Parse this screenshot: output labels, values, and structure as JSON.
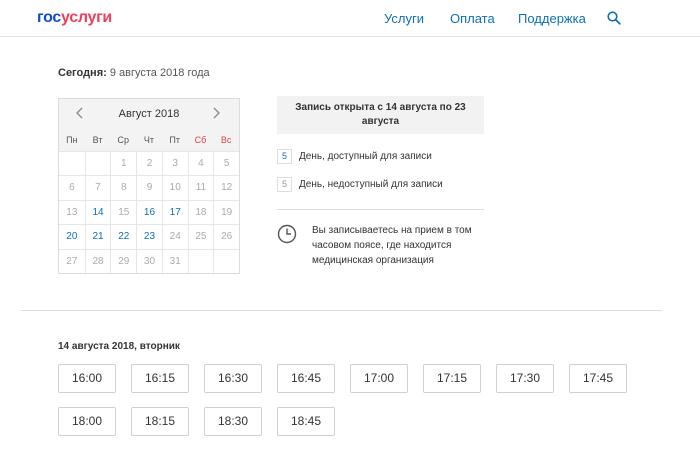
{
  "header": {
    "logo_part1": "гос",
    "logo_part2": "услуги",
    "nav": [
      {
        "label": "Услуги"
      },
      {
        "label": "Оплата"
      },
      {
        "label": "Поддержка"
      }
    ],
    "search_icon": "search-icon"
  },
  "today": {
    "label": "Сегодня:",
    "value": "9 августа 2018 года"
  },
  "calendar": {
    "title": "Август 2018",
    "weekdays": [
      "Пн",
      "Вт",
      "Ср",
      "Чт",
      "Пт",
      "Сб",
      "Вс"
    ],
    "weekend_color": "#e44444",
    "available_color": "#0d6fb8",
    "cells": [
      {
        "d": "",
        "a": false
      },
      {
        "d": "",
        "a": false
      },
      {
        "d": "1",
        "a": false
      },
      {
        "d": "2",
        "a": false
      },
      {
        "d": "3",
        "a": false
      },
      {
        "d": "4",
        "a": false
      },
      {
        "d": "5",
        "a": false
      },
      {
        "d": "6",
        "a": false
      },
      {
        "d": "7",
        "a": false
      },
      {
        "d": "8",
        "a": false
      },
      {
        "d": "9",
        "a": false
      },
      {
        "d": "10",
        "a": false
      },
      {
        "d": "11",
        "a": false
      },
      {
        "d": "12",
        "a": false
      },
      {
        "d": "13",
        "a": false
      },
      {
        "d": "14",
        "a": true
      },
      {
        "d": "15",
        "a": false
      },
      {
        "d": "16",
        "a": true
      },
      {
        "d": "17",
        "a": true
      },
      {
        "d": "18",
        "a": false
      },
      {
        "d": "19",
        "a": false
      },
      {
        "d": "20",
        "a": true
      },
      {
        "d": "21",
        "a": true
      },
      {
        "d": "22",
        "a": true
      },
      {
        "d": "23",
        "a": true
      },
      {
        "d": "24",
        "a": false
      },
      {
        "d": "25",
        "a": false
      },
      {
        "d": "26",
        "a": false
      },
      {
        "d": "27",
        "a": false
      },
      {
        "d": "28",
        "a": false
      },
      {
        "d": "29",
        "a": false
      },
      {
        "d": "30",
        "a": false
      },
      {
        "d": "31",
        "a": false
      },
      {
        "d": "",
        "a": false
      },
      {
        "d": "",
        "a": false
      }
    ]
  },
  "info": {
    "record_open": "Запись открыта с 14 августа по 23 августа",
    "legend_available_num": "5",
    "legend_available": "День, доступный для записи",
    "legend_unavailable_num": "5",
    "legend_unavailable": "День, недоступный для записи",
    "timezone_note": "Вы записываетесь на прием в том часовом поясе, где находится медицинская организация"
  },
  "slots": {
    "title": "14 августа 2018, вторник",
    "times": [
      "16:00",
      "16:15",
      "16:30",
      "16:45",
      "17:00",
      "17:15",
      "17:30",
      "17:45",
      "18:00",
      "18:15",
      "18:30",
      "18:45"
    ]
  }
}
